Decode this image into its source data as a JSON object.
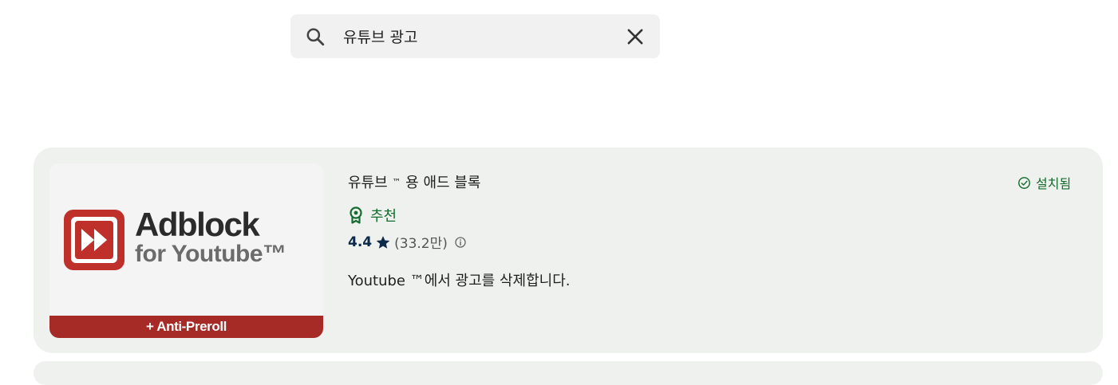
{
  "search": {
    "query": "유튜브 광고",
    "search_icon": "search-icon",
    "clear_icon": "close-icon"
  },
  "result": {
    "thumbnail": {
      "brand": "Adblock",
      "subtitle": "for Youtube™",
      "banner": "+ Anti-Preroll",
      "logo_icon": "fast-forward-icon",
      "colors": {
        "logo": "#c0302a",
        "banner": "#a62a25"
      }
    },
    "title_main": "유튜브",
    "title_tm": "™",
    "title_rest": "용 애드 블록",
    "installed_label": "설치됨",
    "installed_icon": "check-circle-icon",
    "recommended_label": "추천",
    "recommended_icon": "award-badge-icon",
    "rating": "4.4",
    "rating_icon": "star-icon",
    "rating_count": "(33.2만)",
    "info_icon": "info-icon",
    "description": "Youtube ™에서 광고를 삭제합니다."
  },
  "colors": {
    "accent_green": "#146c2e",
    "card_bg": "#eff1ee",
    "search_bg": "#f1f1f1"
  }
}
